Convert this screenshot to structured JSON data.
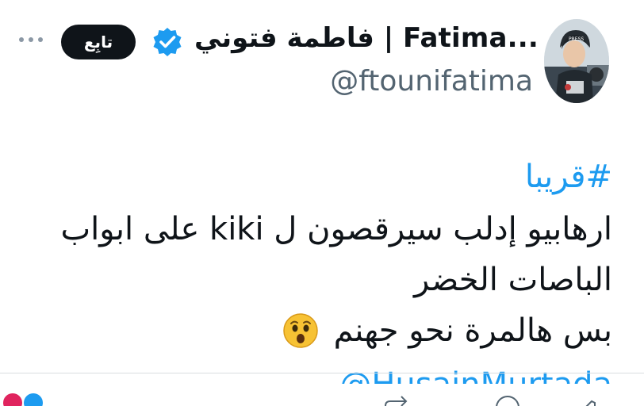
{
  "header": {
    "display_name": "فاطمة فتوني | Fatima...",
    "handle": "@ftounifatima",
    "follow_label": "تابِع",
    "avatar_badge": "PRESS"
  },
  "tweet": {
    "hashtag": "#قريبا",
    "line_1": "ارهابيو إدلب سيرقصون ل kiki على  ابواب",
    "line_2": "الباصات الخضر",
    "line_3": "بس هالمرة نحو جهنم",
    "emoji": "hushed-face",
    "mention_partial": "@HusainMurtada"
  },
  "colors": {
    "link": "#1d9bf0",
    "text": "#0f1419",
    "muted": "#536471",
    "verified": "#1d9bf0",
    "follow_bg": "#0f1419"
  }
}
